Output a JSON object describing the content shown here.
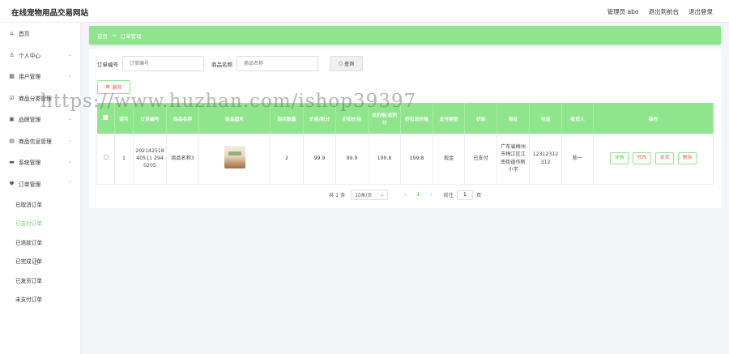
{
  "header": {
    "site_title": "在线宠物用品交易网站",
    "admin_label": "管理员 abo",
    "back_to_front": "退出到前台",
    "logout": "退出登录"
  },
  "sidebar": {
    "items": [
      {
        "label": "首页",
        "icon": "home-icon"
      },
      {
        "label": "个人中心",
        "icon": "user-icon"
      },
      {
        "label": "用户管理",
        "icon": "users-icon"
      },
      {
        "label": "商品分类管理",
        "icon": "category-icon"
      },
      {
        "label": "品牌管理",
        "icon": "brand-icon"
      },
      {
        "label": "商品信息管理",
        "icon": "goods-icon"
      },
      {
        "label": "系统管理",
        "icon": "system-icon"
      },
      {
        "label": "订单管理",
        "icon": "order-icon"
      }
    ],
    "order_sub": [
      "已取消订单",
      "已支付订单",
      "已退款订单",
      "已完成订单",
      "已发货订单",
      "未支付订单"
    ],
    "active_sub": "已支付订单"
  },
  "breadcrumb": {
    "home": "首页",
    "separator": "→",
    "current": "订单管理"
  },
  "search": {
    "order_no_label": "订单编号",
    "order_no_placeholder": "订单编号",
    "goods_name_label": "商品名称",
    "goods_name_placeholder": "商品名称",
    "search_button": "查询"
  },
  "toolbar": {
    "delete_label": "删除"
  },
  "table": {
    "headers": [
      "",
      "索引",
      "订单编号",
      "商品名称",
      "商品图片",
      "购买数量",
      "价格/积分",
      "折扣价格",
      "总价格/总积分",
      "折扣总价格",
      "支付类型",
      "状态",
      "地址",
      "电话",
      "收货人",
      "操作"
    ],
    "rows": [
      {
        "index": "1",
        "order_no": "20214251840511 2940205",
        "goods_name": "商品名称3",
        "qty": "2",
        "price": "99.9",
        "discount_price": "99.9",
        "total": "199.8",
        "discount_total": "199.8",
        "pay_type": "现金",
        "status": "已支付",
        "address": "广东省梅州市梅江区江南街道作新小学",
        "phone": "12312312312",
        "receiver": "陈一"
      }
    ],
    "actions": [
      "详情",
      "修改",
      "发货",
      "删除"
    ]
  },
  "pagination": {
    "total": "共 1 条",
    "page_size": "10条/页",
    "current_page": "1",
    "goto_label": "前往",
    "goto_value": "1",
    "page_suffix": "页"
  },
  "watermark": "https://www.huzhan.com/ishop39397",
  "colors": {
    "accent": "#8fe58c",
    "active_text": "#6dcf68",
    "danger": "#e0655a"
  }
}
